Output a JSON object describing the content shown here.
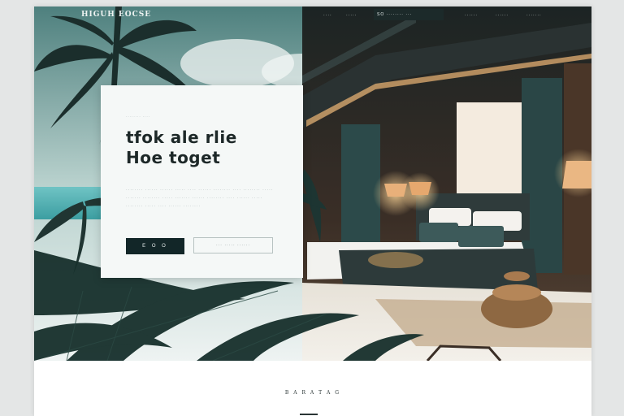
{
  "nav": {
    "brand": "HIGUH EOCSE",
    "links": [
      "····",
      "·····",
      "······",
      "······",
      "·······"
    ],
    "cta_label": "SO ········ ···"
  },
  "hero": {
    "eyebrow": "········ ····",
    "headline_line1": "tfok ale rlie",
    "headline_line2": "Hoe toget",
    "body_copy": "········ ······ ······ ····· ···· ······ ········ ···· ········ ····· ······· ········ ····· ······· ······ ········ ···· ······ ····· ········ ····· ···· ······ ········",
    "primary_button": "E O O",
    "secondary_button": "··· ····· ······"
  },
  "section": {
    "label": "B A R A T A G"
  },
  "colors": {
    "teal_dark": "#122628",
    "card_bg": "#f5f8f7",
    "lamp_glow": "#e8b07a",
    "curtain": "#2c4a4a"
  }
}
